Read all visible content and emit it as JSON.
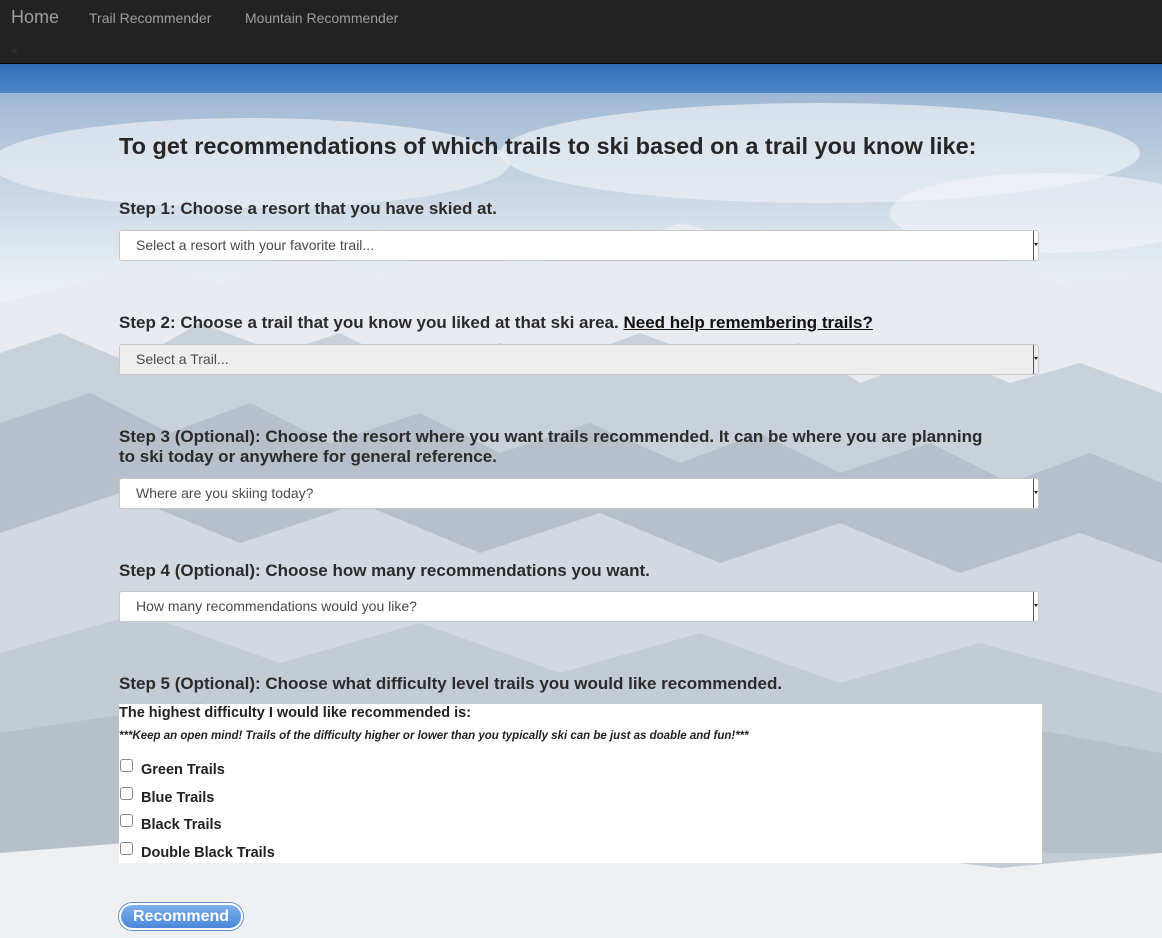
{
  "navbar": {
    "brand": "Home",
    "links": [
      "Trail Recommender",
      "Mountain Recommender"
    ],
    "collapse_glyph": "<"
  },
  "main": {
    "heading": "To get recommendations of which trails to ski based on a trail you know like:",
    "step1": {
      "label": "Step 1: Choose a resort that you have skied at.",
      "select_value": "Select a resort with your favorite trail..."
    },
    "step2": {
      "label": "Step 2: Choose a trail that you know you liked at that ski area.",
      "help_link": "Need help remembering trails?",
      "select_value": "Select a Trail..."
    },
    "step3": {
      "label_line1": "Step 3 (Optional): Choose the resort where you want trails recommended. It can be where you are planning",
      "label_line2": "to ski today or anywhere for general reference.",
      "select_value": "Where are you skiing today?"
    },
    "step4": {
      "label": "Step 4 (Optional): Choose how many recommendations you want.",
      "select_value": "How many recommendations would you like?"
    },
    "step5": {
      "label": "Step 5 (Optional): Choose what difficulty level trails you would like recommended.",
      "panel_title": "The highest difficulty I would like recommended is:",
      "panel_note": "***Keep an open mind! Trails of the difficulty higher or lower than you typically ski can be just as doable and fun!***",
      "options": [
        "Green Trails",
        "Blue Trails",
        "Black Trails",
        "Double Black Trails"
      ]
    },
    "recommend_label": "Recommend"
  }
}
